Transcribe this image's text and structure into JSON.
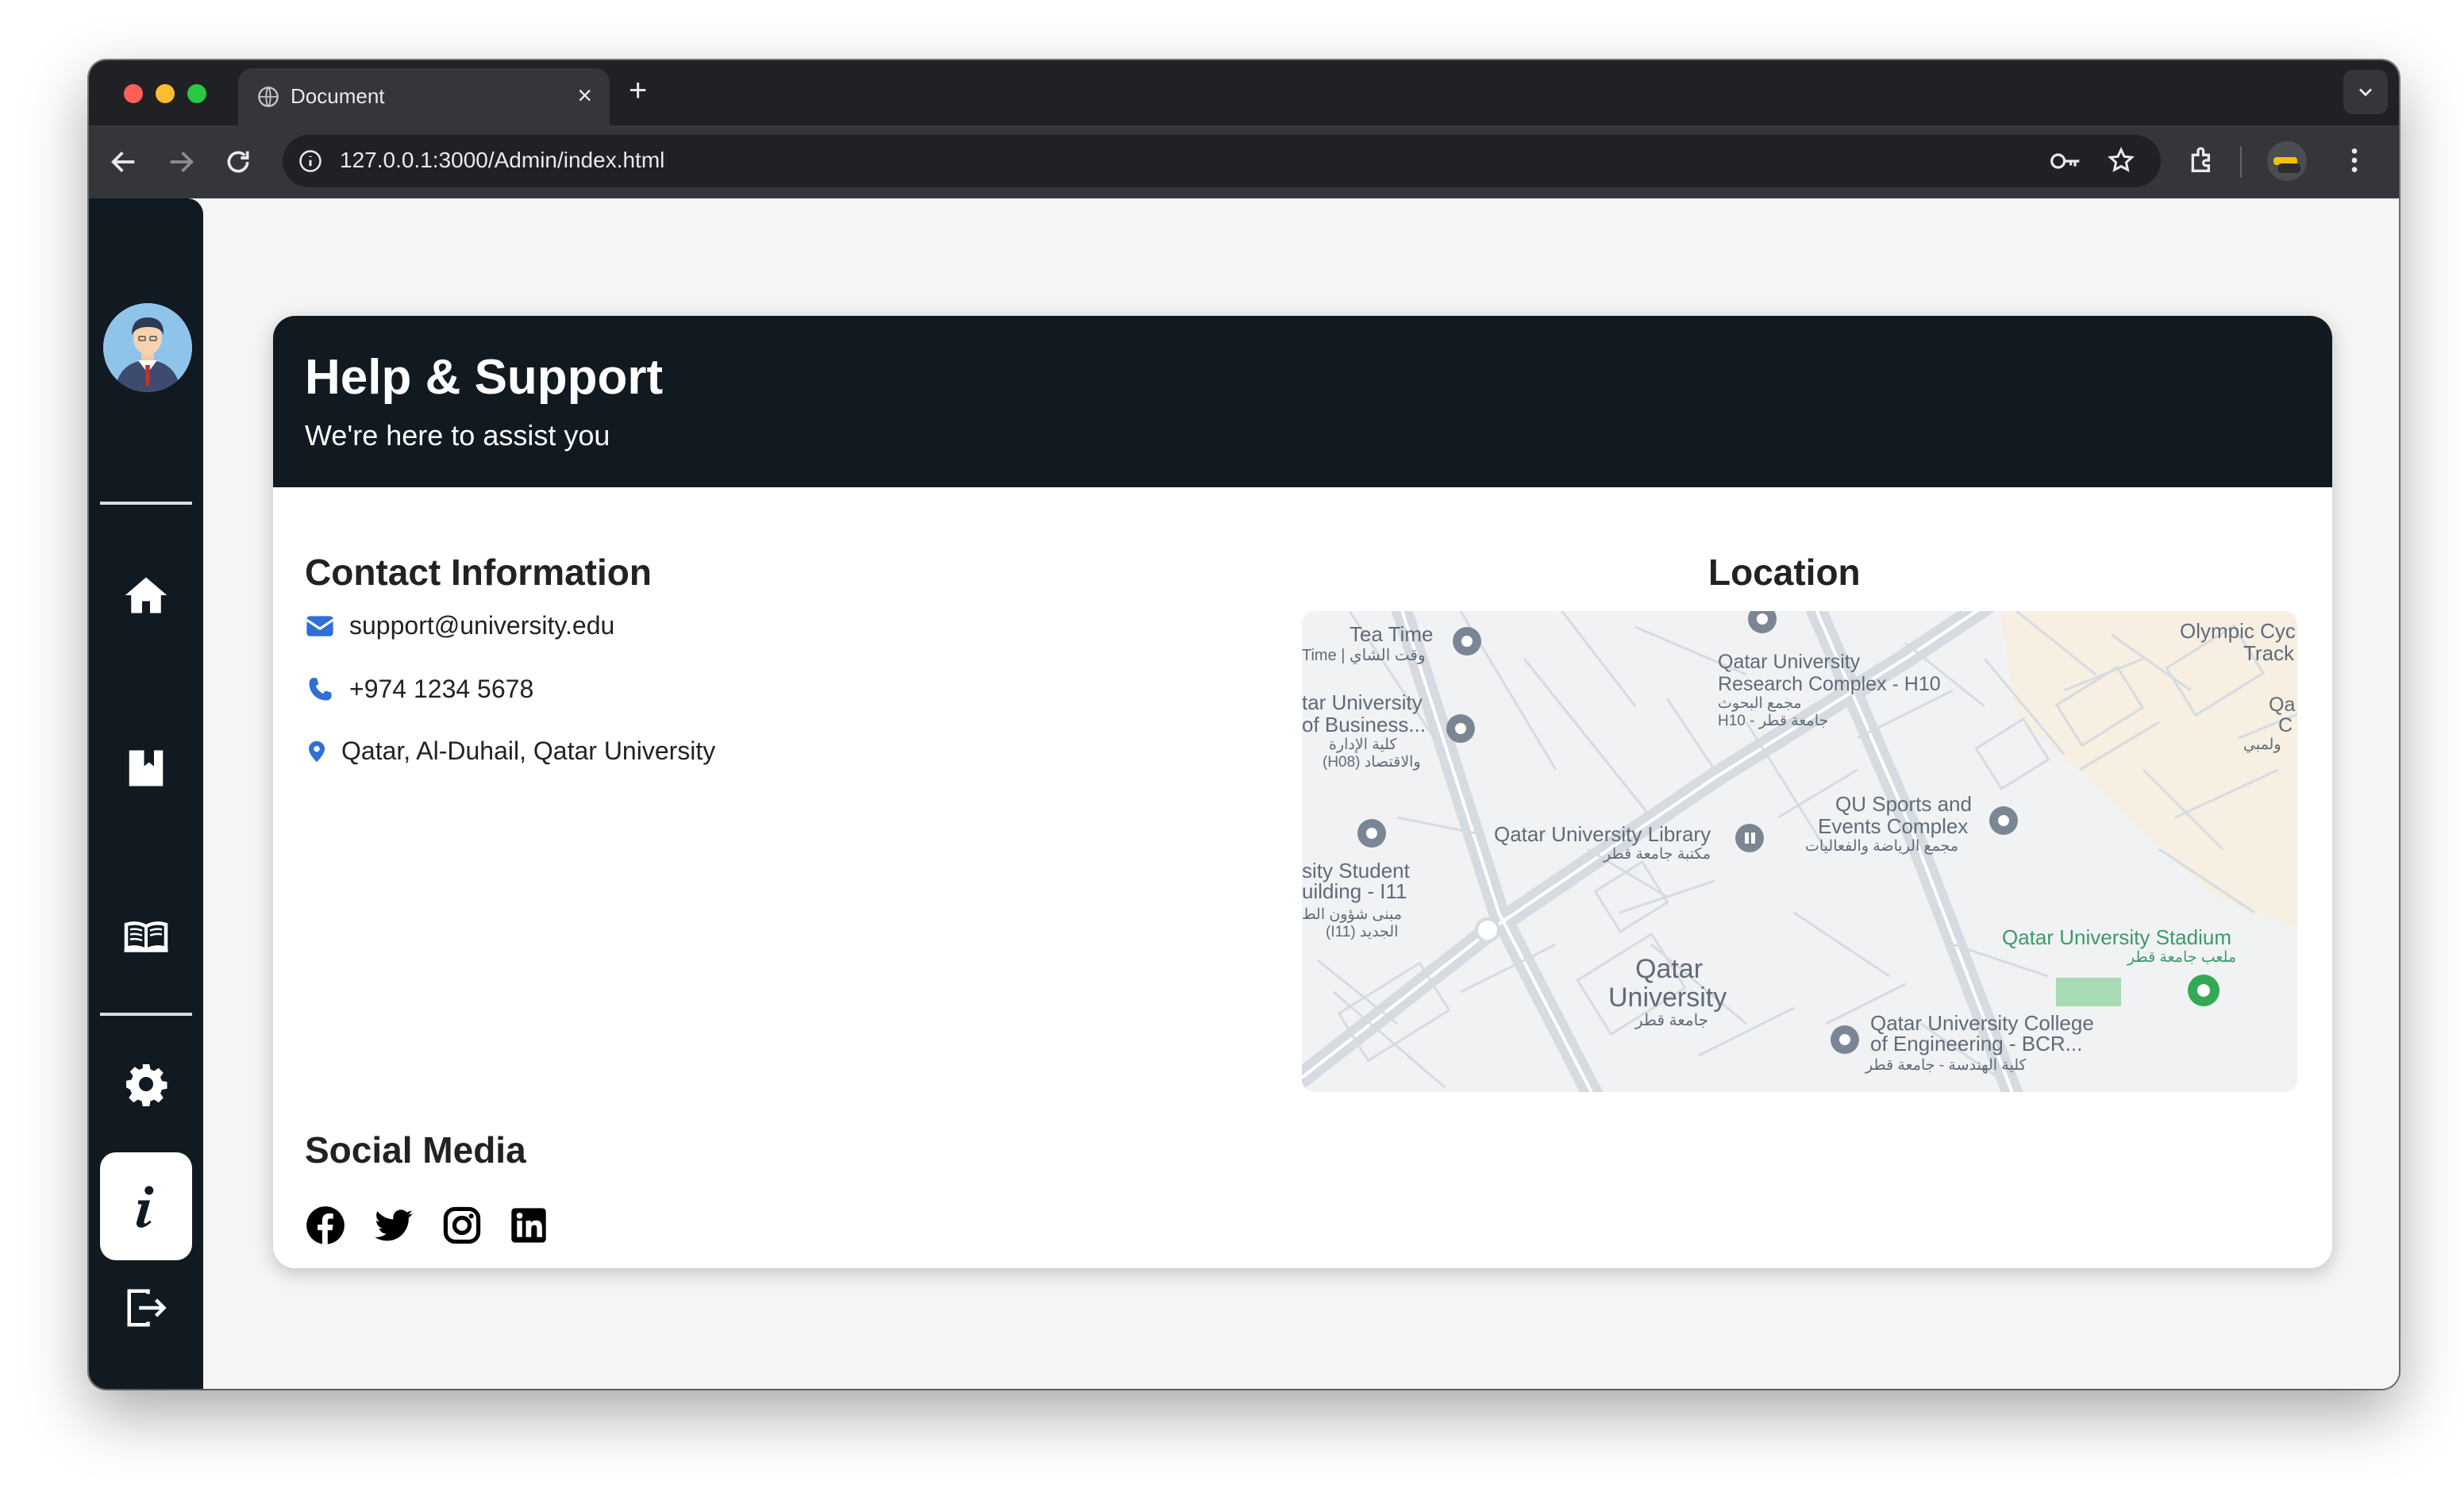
{
  "browser": {
    "tab_title": "Document",
    "new_tab_symbol": "+",
    "close_symbol": "×",
    "url": "127.0.0.1:3000/Admin/index.html"
  },
  "sidebar": {
    "items": [
      {
        "name": "home",
        "icon": "home-icon"
      },
      {
        "name": "bookmark",
        "icon": "bookmark-icon"
      },
      {
        "name": "library",
        "icon": "open-book-icon"
      },
      {
        "name": "settings",
        "icon": "gear-icon"
      },
      {
        "name": "info",
        "icon": "info-icon",
        "active": true
      },
      {
        "name": "logout",
        "icon": "logout-icon"
      }
    ]
  },
  "header": {
    "title": "Help & Support",
    "subtitle": "We're here to assist you"
  },
  "contact": {
    "title": "Contact Information",
    "email": "support@university.edu",
    "phone": "+974 1234 5678",
    "address": "Qatar, Al-Duhail, Qatar University"
  },
  "location": {
    "title": "Location",
    "labels": {
      "tea_time": "Tea Time",
      "tea_time_ar": "Time | وقت الشاي",
      "research": "Qatar University",
      "research2": "Research Complex - H10",
      "research_ar": "مجمع البحوث",
      "research_ar2": "H10 - جامعة قطر",
      "business": "tar University",
      "business2": "of Business...",
      "business_ar": "كلية الإدارة",
      "business_ar2": "(H08) والاقتصاد",
      "olympic": "Olympic Cyc",
      "olympic2": "Track Ma",
      "library": "Qatar University Library",
      "library_ar": "مكتبة جامعة قطر",
      "sports": "QU Sports and",
      "sports2": "Events Complex",
      "sports_ar": "مجمع الرياضة والفعاليات",
      "student": "sity Student",
      "student2": "uilding - I11",
      "student_ar": "مبنى شؤون الط",
      "student_ar2": "(I11) الجديد",
      "qu": "Qatar",
      "qu2": "University",
      "qu_ar": "جامعة قطر",
      "stadium": "Qatar University Stadium",
      "stadium_ar": "ملعب جامعة قطر",
      "engineering": "Qatar University College",
      "engineering2": "of Engineering - BCR...",
      "engineering_ar": "كلية الهندسة - جامعة قطر",
      "edge_q": "Qa",
      "edge_c": "C",
      "edge_ar": "ولمبي"
    }
  },
  "social": {
    "title": "Social Media",
    "icons": [
      "facebook-icon",
      "twitter-icon",
      "instagram-icon",
      "linkedin-icon"
    ]
  },
  "colors": {
    "sidebar_bg": "#111921",
    "accent_blue": "#2f6fd6",
    "page_bg": "#f5f5f5"
  }
}
